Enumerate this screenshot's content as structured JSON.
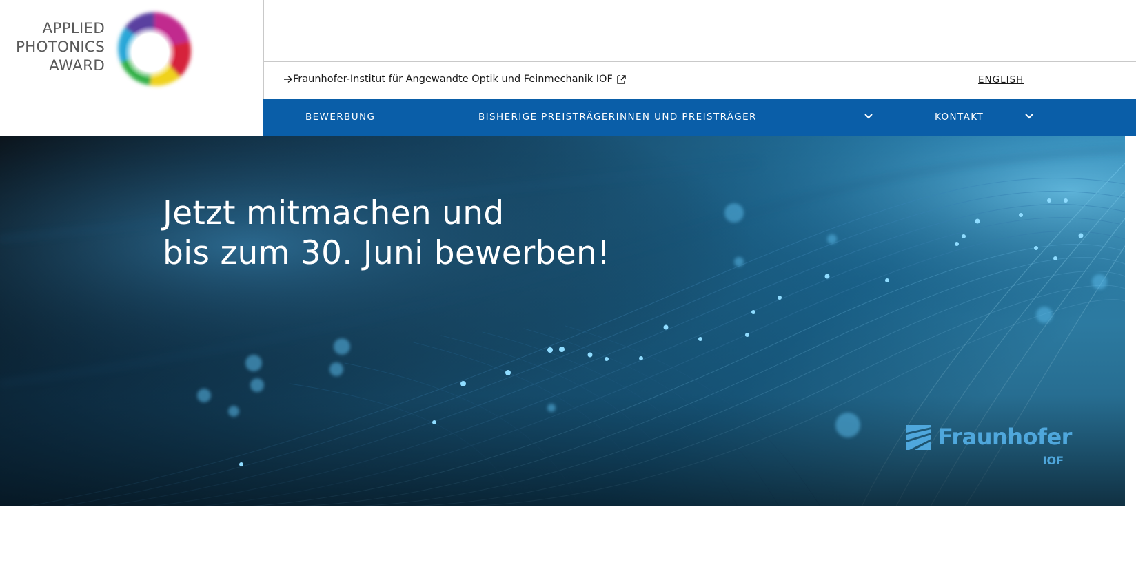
{
  "logo": {
    "line1": "APPLIED",
    "line2": "PHOTONICS",
    "line3": "AWARD"
  },
  "meta": {
    "institute_link": "Fraunhofer-Institut für Angewandte Optik und Feinmechanik IOF",
    "language_link": "ENGLISH"
  },
  "nav": {
    "items": [
      {
        "label": "BEWERBUNG"
      },
      {
        "label": "BISHERIGE PREISTRÄGERINNEN UND PREISTRÄGER"
      },
      {
        "label": "KONTAKT"
      }
    ]
  },
  "hero": {
    "title_line1": "Jetzt mitmachen und",
    "title_line2": "bis zum 30. Juni bewerben!",
    "brand_name": "Fraunhofer",
    "brand_sub": "IOF"
  },
  "colors": {
    "nav_background": "#0a5ea8",
    "brand_accent": "#4fa7dc",
    "hero_background": "#05131f"
  }
}
